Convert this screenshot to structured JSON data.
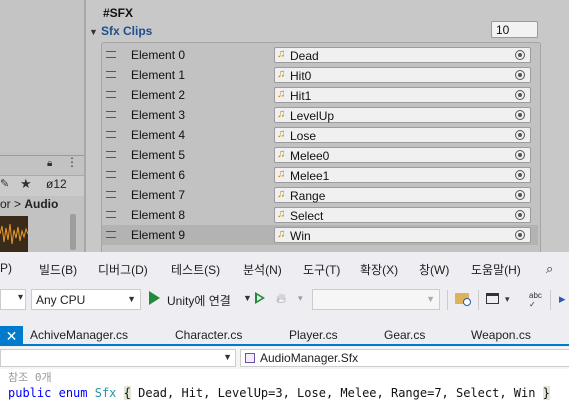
{
  "unity": {
    "left_panel": {
      "more_icon": "⋮",
      "eye_count": "12",
      "breadcrumb_prefix": "or",
      "breadcrumb_current": "Audio"
    },
    "inspector": {
      "section_header": "#SFX",
      "foldout_label": "Sfx Clips",
      "array_size": "10",
      "elements": [
        {
          "label": "Element 0",
          "clip": "Dead"
        },
        {
          "label": "Element 1",
          "clip": "Hit0"
        },
        {
          "label": "Element 2",
          "clip": "Hit1"
        },
        {
          "label": "Element 3",
          "clip": "LevelUp"
        },
        {
          "label": "Element 4",
          "clip": "Lose"
        },
        {
          "label": "Element 5",
          "clip": "Melee0"
        },
        {
          "label": "Element 6",
          "clip": "Melee1"
        },
        {
          "label": "Element 7",
          "clip": "Range"
        },
        {
          "label": "Element 8",
          "clip": "Select"
        },
        {
          "label": "Element 9",
          "clip": "Win"
        }
      ],
      "selected_index": 9
    }
  },
  "vs": {
    "menu": [
      {
        "label": "P)"
      },
      {
        "label": "빌드(B)"
      },
      {
        "label": "디버그(D)"
      },
      {
        "label": "테스트(S)"
      },
      {
        "label": "분석(N)"
      },
      {
        "label": "도구(T)"
      },
      {
        "label": "확장(X)"
      },
      {
        "label": "창(W)"
      },
      {
        "label": "도움말(H)"
      }
    ],
    "toolbar": {
      "platform": "Any CPU",
      "attach_label": "Unity에 연결"
    },
    "tabs": [
      {
        "label": "AchiveManager.cs"
      },
      {
        "label": "Character.cs"
      },
      {
        "label": "Player.cs"
      },
      {
        "label": "Gear.cs"
      },
      {
        "label": "Weapon.cs"
      }
    ],
    "navbar": {
      "member": "AudioManager.Sfx"
    },
    "code": {
      "refs": "참조 0개",
      "kw1": "public",
      "kw2": "enum",
      "type_name": "Sfx",
      "body": " Dead, Hit, LevelUp=3, Lose, Melee, Range=7, Select, Win "
    }
  },
  "colors": {
    "accent": "#007acc",
    "play_green": "#1e8a3a",
    "foldout_blue": "#1f4e8c",
    "keyword_blue": "#0000ff",
    "type_teal": "#2b91af"
  }
}
